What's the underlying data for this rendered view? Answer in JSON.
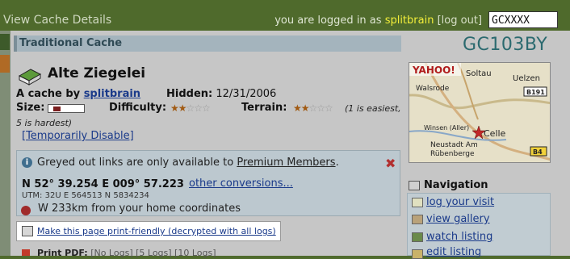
{
  "header": {
    "title": "View Cache Details",
    "login_prefix": "you are logged in as",
    "username": "splitbrain",
    "logout_label": "log out",
    "search_value": "GCXXXX"
  },
  "cache": {
    "type_label": "Traditional Cache",
    "code": "GC103BY",
    "name": "Alte Ziegelei",
    "by_label": "A cache by",
    "owner": "splitbrain",
    "hidden_label": "Hidden:",
    "hidden_date": "12/31/2006",
    "size_label": "Size:",
    "difficulty_label": "Difficulty:",
    "terrain_label": "Terrain:",
    "difficulty_stars": 2,
    "terrain_stars": 2,
    "scale_note_1": "(1 is easiest,",
    "scale_note_2": "5 is hardest)",
    "disable_link": "[Temporarily Disable]"
  },
  "info": {
    "text": "Greyed out links are only available to",
    "link": "Premium Members",
    "suffix": ".",
    "coords": "N 52° 39.254 E 009° 57.223",
    "convert_link": "other conversions...",
    "utm": "UTM: 32U E 564513 N 5834234",
    "distance": "W 233km from your home coordinates"
  },
  "print": {
    "label": "Make this page print-friendly (decrypted with all logs)",
    "pdf_label": "Print PDF:",
    "pdf_options": "[No Logs] [5 Logs] [10 Logs]"
  },
  "map": {
    "brand": "YAHOO!",
    "towns": [
      "Soltau",
      "Walsrode",
      "Uelzen",
      "Winsen (Aller)",
      "Celle",
      "Neustadt Am",
      "Rübenberge"
    ],
    "roads": [
      "B191",
      "B4"
    ]
  },
  "navigation": {
    "title": "Navigation",
    "items": [
      {
        "label": "log your visit",
        "icon": "pencil-icon"
      },
      {
        "label": "view gallery",
        "icon": "gallery-icon"
      },
      {
        "label": "watch listing",
        "icon": "binoculars-icon"
      },
      {
        "label": "edit listing",
        "icon": "edit-icon"
      }
    ]
  }
}
